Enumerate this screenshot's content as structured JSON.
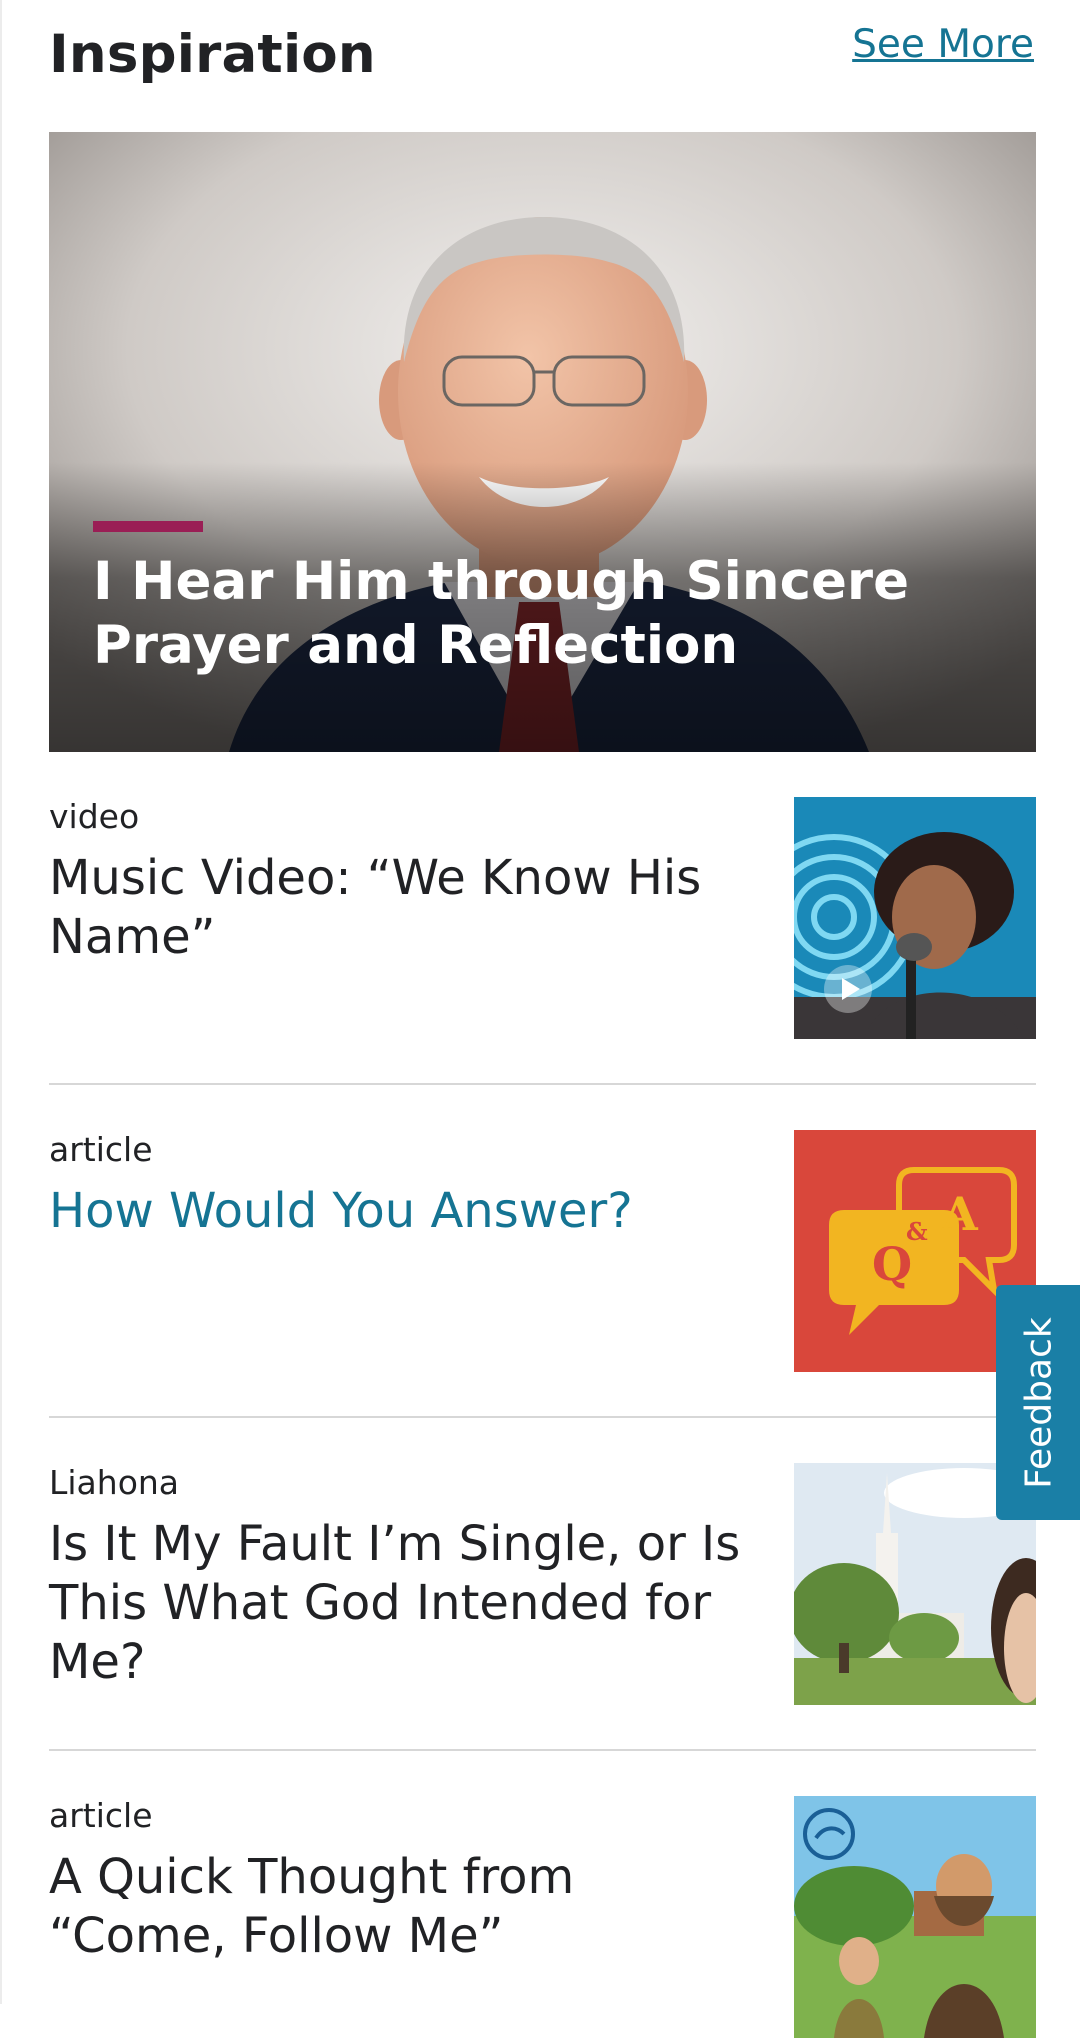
{
  "section": {
    "title": "Inspiration",
    "see_more": "See More"
  },
  "hero": {
    "title": "I Hear Him through Sincere Prayer and Reflection",
    "accent_color": "#9a1e55"
  },
  "items": [
    {
      "category": "video",
      "title": "Music Video: “We Know His Name”",
      "thumbnail_icon": "play-icon"
    },
    {
      "category": "article",
      "title": "How Would You Answer?",
      "thumbnail_glyphs": {
        "q": "Q",
        "amp": "&",
        "a": "A"
      }
    },
    {
      "category": "Liahona",
      "title": "Is It My Fault I’m Single, or Is This What God Intended for Me?"
    },
    {
      "category": "article",
      "title": "A Quick Thought from “Come, Follow Me”"
    }
  ],
  "feedback": {
    "label": "Feedback"
  },
  "colors": {
    "link": "#157493",
    "feedback_tab": "#1a7fa6",
    "text": "#212225",
    "divider": "#d7d7d7"
  }
}
